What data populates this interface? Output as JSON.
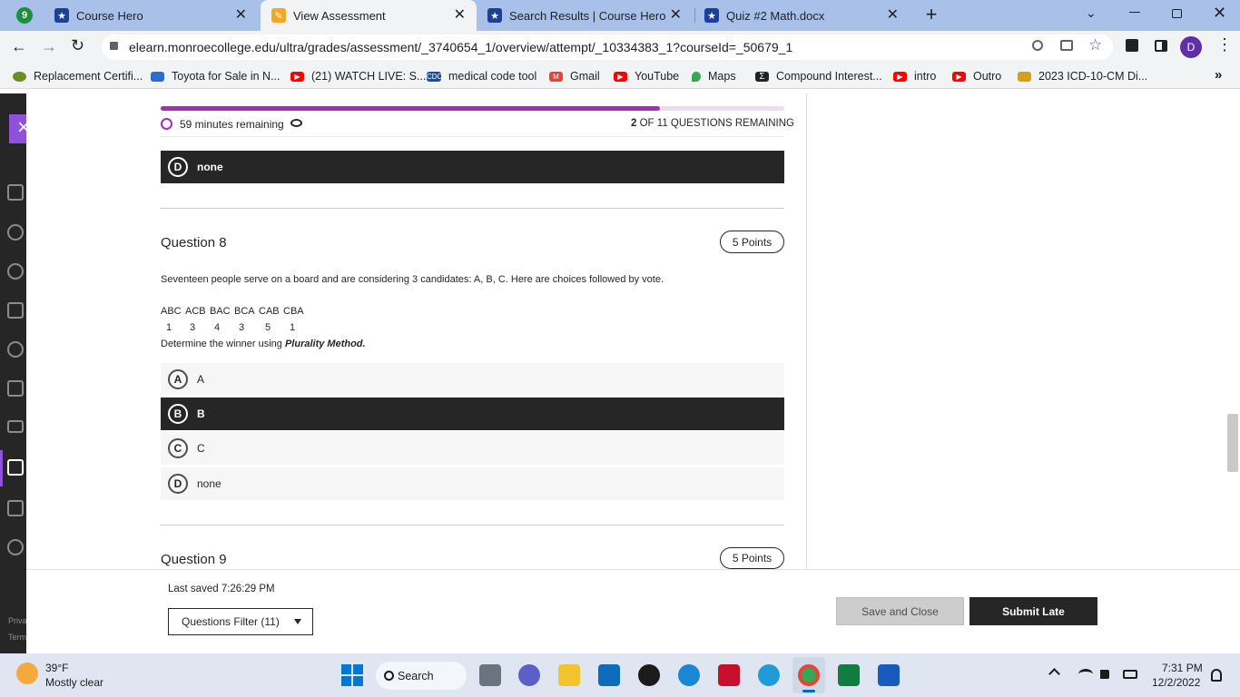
{
  "browser": {
    "tabs": [
      {
        "label": "Course Hero",
        "favicon_color": "#1b3f9a"
      },
      {
        "label": "View Assessment",
        "favicon_color": "#f5a623",
        "active": true
      },
      {
        "label": "Search Results | Course Hero",
        "favicon_color": "#1b3f9a"
      },
      {
        "label": "Quiz #2 Math.docx",
        "favicon_color": "#1b3f9a"
      }
    ],
    "first_tab_icon_text": "9",
    "url": "elearn.monroecollege.edu/ultra/grades/assessment/_3740654_1/overview/attempt/_10334383_1?courseId=_50679_1",
    "profile_initial": "D",
    "bookmarks": [
      {
        "label": "Replacement Certifi...",
        "icon_color": "#6b8e23"
      },
      {
        "label": "Toyota for Sale in N...",
        "icon_color": "#2b6bd6"
      },
      {
        "label": "(21) WATCH LIVE: S...",
        "icon_color": "#ff0000"
      },
      {
        "label": "medical code tool",
        "icon_color": "#1a4f9c",
        "icon_text": "CDC"
      },
      {
        "label": "Gmail",
        "icon_color": "#ea4335"
      },
      {
        "label": "YouTube",
        "icon_color": "#ff0000"
      },
      {
        "label": "Maps",
        "icon_color": "#34a853"
      },
      {
        "label": "Compound Interest...",
        "icon_color": "#202124"
      },
      {
        "label": "intro",
        "icon_color": "#ff0000"
      },
      {
        "label": "Outro",
        "icon_color": "#ff0000"
      },
      {
        "label": "2023 ICD-10-CM Di...",
        "icon_color": "#d4a017"
      }
    ]
  },
  "assessment": {
    "time_remaining": "59 minutes remaining",
    "questions_done": "2",
    "questions_remaining_suffix": "OF 11 QUESTIONS REMAINING",
    "progress_fraction": 0.8,
    "prev_option": {
      "letter": "D",
      "text": "none",
      "selected": true
    },
    "question8": {
      "title": "Question 8",
      "points": "5 Points",
      "prompt": "Seventeen people serve on a board and are considering 3 candidates: A, B, C. Here are choices followed by vote.",
      "table_headers": [
        "ABC",
        "ACB",
        "BAC",
        "BCA",
        "CAB",
        "CBA"
      ],
      "table_values": [
        "1",
        "3",
        "4",
        "3",
        "5",
        "1"
      ],
      "instruction_prefix": "Determine the winner using ",
      "instruction_method": "Plurality Method.",
      "options": [
        {
          "letter": "A",
          "text": "A",
          "selected": false
        },
        {
          "letter": "B",
          "text": "B",
          "selected": true
        },
        {
          "letter": "C",
          "text": "C",
          "selected": false
        },
        {
          "letter": "D",
          "text": "none",
          "selected": false
        }
      ]
    },
    "question9": {
      "title": "Question 9",
      "points": "5 Points"
    }
  },
  "footer": {
    "last_saved": "Last saved 7:26:29 PM",
    "filter_label": "Questions Filter (11)",
    "save_close": "Save and Close",
    "submit": "Submit Late",
    "priv_text": "Priva",
    "terms_text": "Term"
  },
  "taskbar": {
    "weather_temp": "39°F",
    "weather_desc": "Mostly clear",
    "search_label": "Search",
    "time": "7:31 PM",
    "date": "12/2/2022"
  }
}
